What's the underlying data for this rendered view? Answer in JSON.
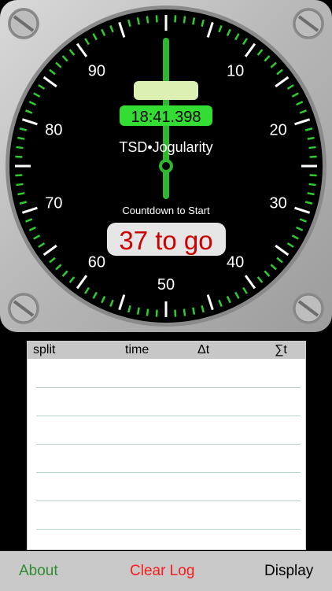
{
  "instrument": {
    "dial_numbers": [
      "10",
      "20",
      "30",
      "40",
      "50",
      "60",
      "70",
      "80",
      "90"
    ],
    "clock": "18:41.398",
    "brand": "TSD•Jogularity",
    "countdown_label": "Countdown to Start",
    "countdown_value": "37 to go",
    "colors": {
      "face": "#000000",
      "tick_major": "#ffffff",
      "tick_minor": "#2ecc2e",
      "hand": "#2fb82f",
      "clock_bg": "#33dd33",
      "countdown_text": "#cc0000"
    }
  },
  "log": {
    "headers": [
      "split",
      "time",
      "Δt",
      "∑t"
    ],
    "rows": 6
  },
  "toolbar": {
    "about": "About",
    "clear_log": "Clear Log",
    "display": "Display",
    "colors": {
      "about": "#2e8b2e",
      "clear_log": "#ff1a1a",
      "display": "#000000"
    }
  }
}
